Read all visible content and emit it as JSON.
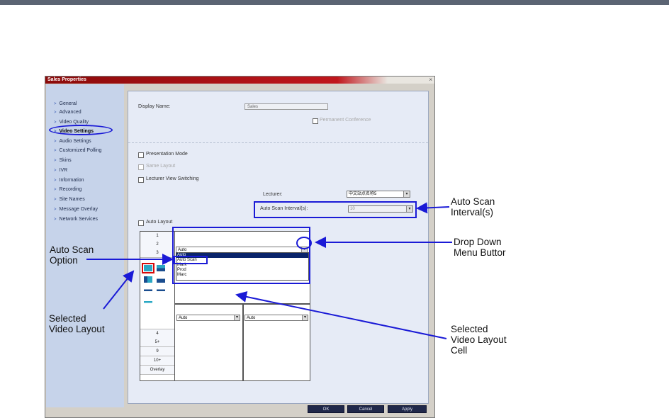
{
  "dialog": {
    "title": "Sales Properties",
    "close_glyph": "×",
    "title_color": "#b0121a",
    "nav": [
      {
        "label": "General",
        "active": false
      },
      {
        "label": "Advanced",
        "active": false
      },
      {
        "label": "Video Quality",
        "active": false
      },
      {
        "label": "Video Settings",
        "active": true
      },
      {
        "label": "Audio Settings",
        "active": false
      },
      {
        "label": "Customized Polling",
        "active": false
      },
      {
        "label": "Skins",
        "active": false
      },
      {
        "label": "IVR",
        "active": false
      },
      {
        "label": "Information",
        "active": false
      },
      {
        "label": "Recording",
        "active": false
      },
      {
        "label": "Site Names",
        "active": false
      },
      {
        "label": "Message Overlay",
        "active": false
      },
      {
        "label": "Network Services",
        "active": false
      }
    ],
    "display_name_label": "Display Name:",
    "display_name_value": "Sales",
    "permanent_conference": "Permanent Conference",
    "presentation_mode": "Presentation Mode",
    "same_layout": "Same Layout",
    "lecturer_view_switching": "Lecturer View Switching",
    "lecturer_label": "Lecturer:",
    "lecturer_value": "中文站点名称5",
    "auto_scan_interval_label": "Auto Scan Interval(s):",
    "auto_scan_interval_value": "10",
    "auto_layout": "Auto Layout",
    "layout_tabs_top": [
      "1",
      "2",
      "3"
    ],
    "layout_tabs_bottom": [
      "4",
      "5+",
      "9",
      "10+",
      "Overlay"
    ],
    "cell_dropdown_value": "Auto",
    "dropdown_options": [
      "Auto",
      "Auto Scan",
      "Mark",
      "Prod",
      "Marc"
    ],
    "bottom_cell_left": "Auto",
    "bottom_cell_right": "Auto",
    "buttons": {
      "ok": "OK",
      "cancel": "Cancel",
      "apply": "Apply"
    },
    "dropdown_arrow": "▾"
  },
  "callouts": {
    "auto_scan_interval": [
      "Auto Scan",
      "Interval(s)"
    ],
    "drop_down_menu": [
      "Drop Down",
      "Menu Buttor"
    ],
    "auto_scan_option": [
      "Auto Scan",
      "Option"
    ],
    "selected_video_layout": [
      "Selected",
      "Video Layout"
    ],
    "selected_video_layout_cell": [
      "Selected",
      "Video Layout",
      "Cell"
    ]
  },
  "colors": {
    "annotation_blue": "#1a1ad6",
    "annotation_red": "#d60a0a",
    "sidebar": "#c6d3ea"
  }
}
